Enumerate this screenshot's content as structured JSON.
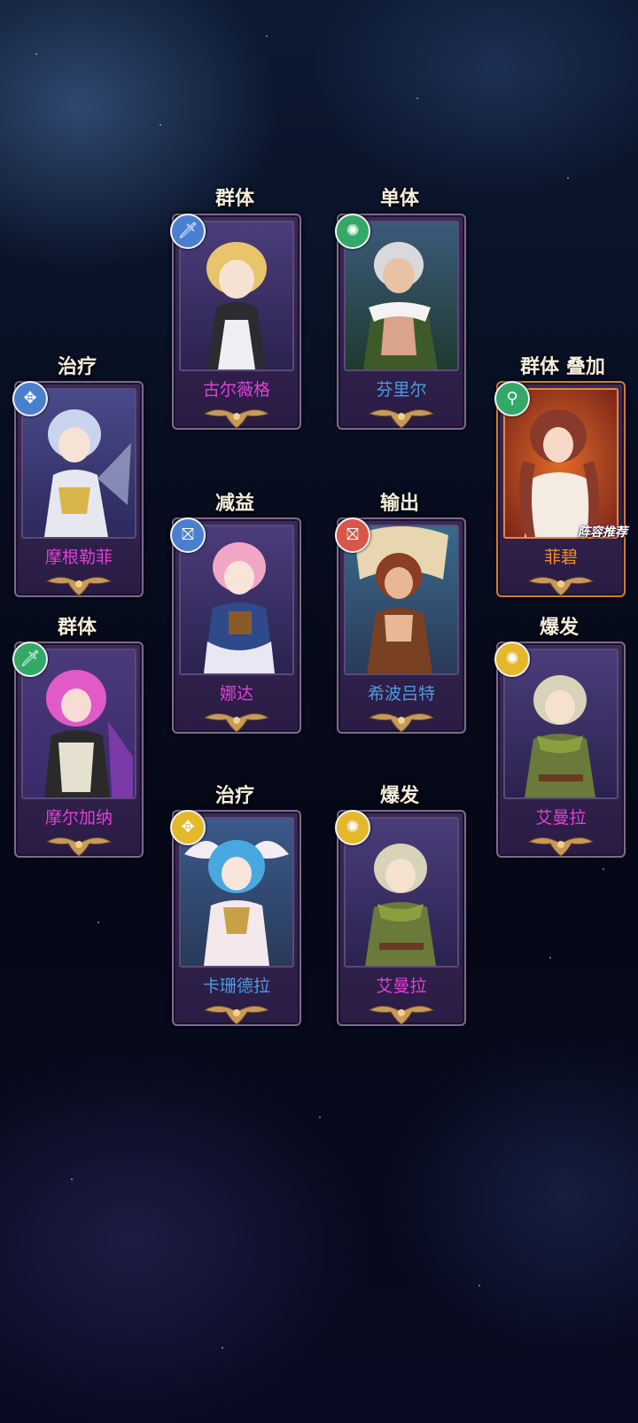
{
  "colors": {
    "name_magenta": "#e040d8",
    "name_blue": "#4f9ae0",
    "name_orange": "#f09028",
    "label_cream": "#f4ecdc",
    "icon_blue": "#4a7fd0",
    "icon_green": "#33a867",
    "icon_red": "#d9574a",
    "icon_yellow": "#e5b72b"
  },
  "heroes": [
    {
      "role": "群体",
      "name": "古尔薇格",
      "name_color": "#e040d8",
      "icon": "sword-icon",
      "icon_color": "#4a7fd0",
      "portrait_color": "#5a4b85"
    },
    {
      "role": "单体",
      "name": "芬里尔",
      "name_color": "#4f9ae0",
      "icon": "swirl-icon",
      "icon_color": "#33a867",
      "portrait_color": "#3f6a55"
    },
    {
      "role": "治疗",
      "name": "摩根勒菲",
      "name_color": "#e040d8",
      "icon": "wing-icon",
      "icon_color": "#4a7fd0",
      "portrait_color": "#5b4c8f"
    },
    {
      "role": "群体 叠加",
      "name": "菲碧",
      "name_color": "#f09028",
      "icon": "magnifier-icon",
      "icon_color": "#33a867",
      "portrait_color": "#b8542d",
      "badge": "阵容推荐"
    },
    {
      "role": "减益",
      "name": "娜达",
      "name_color": "#e040d8",
      "icon": "debuff-icon",
      "icon_color": "#4a7fd0",
      "portrait_color": "#5a4b85"
    },
    {
      "role": "输出",
      "name": "希波吕特",
      "name_color": "#4f9ae0",
      "icon": "debuff-icon",
      "icon_color": "#d9574a",
      "portrait_color": "#2f5e7a"
    },
    {
      "role": "群体",
      "name": "摩尔加纳",
      "name_color": "#e040d8",
      "icon": "sword-icon",
      "icon_color": "#33a867",
      "portrait_color": "#5b4c8f"
    },
    {
      "role": "爆发",
      "name": "艾曼拉",
      "name_color": "#e040d8",
      "icon": "swirl-icon",
      "icon_color": "#e5b72b",
      "portrait_color": "#5a4b85"
    },
    {
      "role": "治疗",
      "name": "卡珊德拉",
      "name_color": "#4f9ae0",
      "icon": "wing-icon",
      "icon_color": "#e5b72b",
      "portrait_color": "#2f5e7a"
    },
    {
      "role": "爆发",
      "name": "艾曼拉",
      "name_color": "#e040d8",
      "icon": "swirl-icon",
      "icon_color": "#e5b72b",
      "portrait_color": "#5a4b85"
    }
  ]
}
